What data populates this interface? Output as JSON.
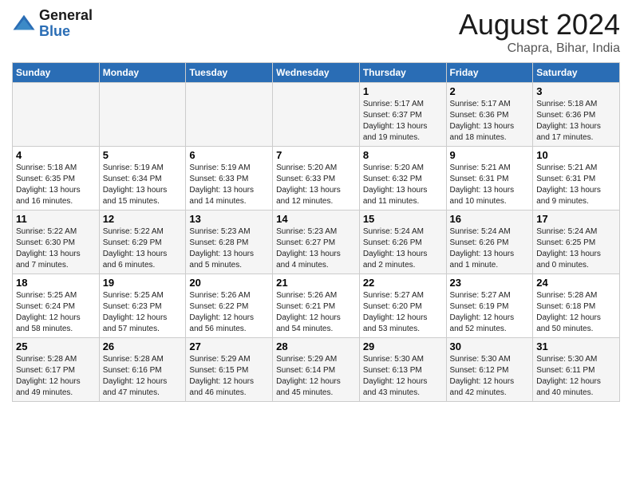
{
  "header": {
    "logo_general": "General",
    "logo_blue": "Blue",
    "month_title": "August 2024",
    "location": "Chapra, Bihar, India"
  },
  "days_of_week": [
    "Sunday",
    "Monday",
    "Tuesday",
    "Wednesday",
    "Thursday",
    "Friday",
    "Saturday"
  ],
  "weeks": [
    [
      {
        "num": "",
        "info": ""
      },
      {
        "num": "",
        "info": ""
      },
      {
        "num": "",
        "info": ""
      },
      {
        "num": "",
        "info": ""
      },
      {
        "num": "1",
        "info": "Sunrise: 5:17 AM\nSunset: 6:37 PM\nDaylight: 13 hours\nand 19 minutes."
      },
      {
        "num": "2",
        "info": "Sunrise: 5:17 AM\nSunset: 6:36 PM\nDaylight: 13 hours\nand 18 minutes."
      },
      {
        "num": "3",
        "info": "Sunrise: 5:18 AM\nSunset: 6:36 PM\nDaylight: 13 hours\nand 17 minutes."
      }
    ],
    [
      {
        "num": "4",
        "info": "Sunrise: 5:18 AM\nSunset: 6:35 PM\nDaylight: 13 hours\nand 16 minutes."
      },
      {
        "num": "5",
        "info": "Sunrise: 5:19 AM\nSunset: 6:34 PM\nDaylight: 13 hours\nand 15 minutes."
      },
      {
        "num": "6",
        "info": "Sunrise: 5:19 AM\nSunset: 6:33 PM\nDaylight: 13 hours\nand 14 minutes."
      },
      {
        "num": "7",
        "info": "Sunrise: 5:20 AM\nSunset: 6:33 PM\nDaylight: 13 hours\nand 12 minutes."
      },
      {
        "num": "8",
        "info": "Sunrise: 5:20 AM\nSunset: 6:32 PM\nDaylight: 13 hours\nand 11 minutes."
      },
      {
        "num": "9",
        "info": "Sunrise: 5:21 AM\nSunset: 6:31 PM\nDaylight: 13 hours\nand 10 minutes."
      },
      {
        "num": "10",
        "info": "Sunrise: 5:21 AM\nSunset: 6:31 PM\nDaylight: 13 hours\nand 9 minutes."
      }
    ],
    [
      {
        "num": "11",
        "info": "Sunrise: 5:22 AM\nSunset: 6:30 PM\nDaylight: 13 hours\nand 7 minutes."
      },
      {
        "num": "12",
        "info": "Sunrise: 5:22 AM\nSunset: 6:29 PM\nDaylight: 13 hours\nand 6 minutes."
      },
      {
        "num": "13",
        "info": "Sunrise: 5:23 AM\nSunset: 6:28 PM\nDaylight: 13 hours\nand 5 minutes."
      },
      {
        "num": "14",
        "info": "Sunrise: 5:23 AM\nSunset: 6:27 PM\nDaylight: 13 hours\nand 4 minutes."
      },
      {
        "num": "15",
        "info": "Sunrise: 5:24 AM\nSunset: 6:26 PM\nDaylight: 13 hours\nand 2 minutes."
      },
      {
        "num": "16",
        "info": "Sunrise: 5:24 AM\nSunset: 6:26 PM\nDaylight: 13 hours\nand 1 minute."
      },
      {
        "num": "17",
        "info": "Sunrise: 5:24 AM\nSunset: 6:25 PM\nDaylight: 13 hours\nand 0 minutes."
      }
    ],
    [
      {
        "num": "18",
        "info": "Sunrise: 5:25 AM\nSunset: 6:24 PM\nDaylight: 12 hours\nand 58 minutes."
      },
      {
        "num": "19",
        "info": "Sunrise: 5:25 AM\nSunset: 6:23 PM\nDaylight: 12 hours\nand 57 minutes."
      },
      {
        "num": "20",
        "info": "Sunrise: 5:26 AM\nSunset: 6:22 PM\nDaylight: 12 hours\nand 56 minutes."
      },
      {
        "num": "21",
        "info": "Sunrise: 5:26 AM\nSunset: 6:21 PM\nDaylight: 12 hours\nand 54 minutes."
      },
      {
        "num": "22",
        "info": "Sunrise: 5:27 AM\nSunset: 6:20 PM\nDaylight: 12 hours\nand 53 minutes."
      },
      {
        "num": "23",
        "info": "Sunrise: 5:27 AM\nSunset: 6:19 PM\nDaylight: 12 hours\nand 52 minutes."
      },
      {
        "num": "24",
        "info": "Sunrise: 5:28 AM\nSunset: 6:18 PM\nDaylight: 12 hours\nand 50 minutes."
      }
    ],
    [
      {
        "num": "25",
        "info": "Sunrise: 5:28 AM\nSunset: 6:17 PM\nDaylight: 12 hours\nand 49 minutes."
      },
      {
        "num": "26",
        "info": "Sunrise: 5:28 AM\nSunset: 6:16 PM\nDaylight: 12 hours\nand 47 minutes."
      },
      {
        "num": "27",
        "info": "Sunrise: 5:29 AM\nSunset: 6:15 PM\nDaylight: 12 hours\nand 46 minutes."
      },
      {
        "num": "28",
        "info": "Sunrise: 5:29 AM\nSunset: 6:14 PM\nDaylight: 12 hours\nand 45 minutes."
      },
      {
        "num": "29",
        "info": "Sunrise: 5:30 AM\nSunset: 6:13 PM\nDaylight: 12 hours\nand 43 minutes."
      },
      {
        "num": "30",
        "info": "Sunrise: 5:30 AM\nSunset: 6:12 PM\nDaylight: 12 hours\nand 42 minutes."
      },
      {
        "num": "31",
        "info": "Sunrise: 5:30 AM\nSunset: 6:11 PM\nDaylight: 12 hours\nand 40 minutes."
      }
    ]
  ]
}
